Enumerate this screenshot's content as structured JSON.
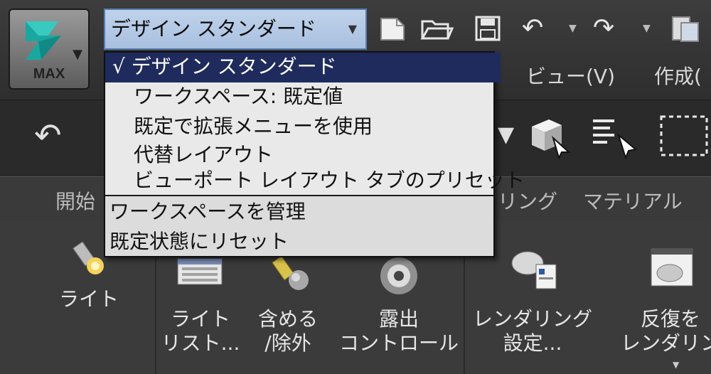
{
  "app_button": {
    "label": "MAX",
    "logo_icon": "3dsmax-logo-icon"
  },
  "workspace_combo": {
    "value": "デザイン スタンダード"
  },
  "quick_access": [
    "new-file-icon",
    "open-folder-icon",
    "save-icon",
    "undo-icon",
    "redo-icon",
    "project-icon"
  ],
  "menubar": {
    "view": "ビュー(V)",
    "create": "作成("
  },
  "workspace_menu": {
    "items": [
      {
        "label": "√ デザイン スタンダード",
        "selected": true
      },
      {
        "label": "ワークスペース: 既定値"
      },
      {
        "label": "既定で拡張メニューを使用"
      },
      {
        "label": "代替レイアウト"
      },
      {
        "label": "ビューポート レイアウト タブのプリセット"
      }
    ],
    "actions": [
      {
        "label": "ワークスペースを管理"
      },
      {
        "label": "既定状態にリセット"
      }
    ]
  },
  "ribbon_tabs": [
    "開始",
    "リング",
    "マテリアル"
  ],
  "ribbon_buttons": {
    "light": "ライト",
    "light_list": [
      "ライト",
      "リスト..."
    ],
    "include": [
      "含める",
      "/除外"
    ],
    "exposure": [
      "露出",
      "コントロール"
    ],
    "render_setup": [
      "レンダリング",
      "設定..."
    ],
    "iterative": [
      "反復を",
      "レンダリン"
    ]
  }
}
